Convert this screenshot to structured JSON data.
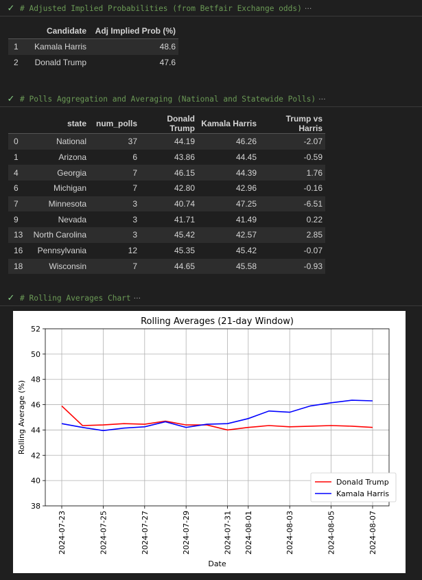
{
  "cells": [
    {
      "code": "# Adjusted Implied Probabilities (from Betfair Exchange odds)",
      "ellipsis": "···"
    },
    {
      "code": "# Polls Aggregation and Averaging (National and Statewide Polls)",
      "ellipsis": "···"
    },
    {
      "code": "# Rolling Averages Chart",
      "ellipsis": "···"
    }
  ],
  "prob_table": {
    "headers": [
      "",
      "Candidate",
      "Adj Implied Prob (%)"
    ],
    "rows": [
      [
        "1",
        "Kamala Harris",
        "48.6"
      ],
      [
        "2",
        "Donald Trump",
        "47.6"
      ]
    ]
  },
  "polls_table": {
    "headers": [
      "",
      "state",
      "num_polls",
      "Donald Trump",
      "Kamala Harris",
      "Trump vs Harris"
    ],
    "rows": [
      [
        "0",
        "National",
        "37",
        "44.19",
        "46.26",
        "-2.07"
      ],
      [
        "1",
        "Arizona",
        "6",
        "43.86",
        "44.45",
        "-0.59"
      ],
      [
        "4",
        "Georgia",
        "7",
        "46.15",
        "44.39",
        "1.76"
      ],
      [
        "6",
        "Michigan",
        "7",
        "42.80",
        "42.96",
        "-0.16"
      ],
      [
        "7",
        "Minnesota",
        "3",
        "40.74",
        "47.25",
        "-6.51"
      ],
      [
        "9",
        "Nevada",
        "3",
        "41.71",
        "41.49",
        "0.22"
      ],
      [
        "13",
        "North Carolina",
        "3",
        "45.42",
        "42.57",
        "2.85"
      ],
      [
        "16",
        "Pennsylvania",
        "12",
        "45.35",
        "45.42",
        "-0.07"
      ],
      [
        "18",
        "Wisconsin",
        "7",
        "44.65",
        "45.58",
        "-0.93"
      ]
    ]
  },
  "chart_data": {
    "type": "line",
    "title": "Rolling Averages (21-day Window)",
    "xlabel": "Date",
    "ylabel": "Rolling Average (%)",
    "x": [
      "2024-07-23",
      "2024-07-24",
      "2024-07-25",
      "2024-07-26",
      "2024-07-27",
      "2024-07-28",
      "2024-07-29",
      "2024-07-30",
      "2024-07-31",
      "2024-08-01",
      "2024-08-02",
      "2024-08-03",
      "2024-08-04",
      "2024-08-05",
      "2024-08-06",
      "2024-08-07"
    ],
    "xticks": [
      "2024-07-23",
      "2024-07-25",
      "2024-07-27",
      "2024-07-29",
      "2024-07-31",
      "2024-08-01",
      "2024-08-03",
      "2024-08-05",
      "2024-08-07"
    ],
    "ylim": [
      38,
      52
    ],
    "yticks": [
      38,
      40,
      42,
      44,
      46,
      48,
      50,
      52
    ],
    "grid": true,
    "legend": "lower-right",
    "series": [
      {
        "name": "Donald Trump",
        "color": "#ff0000",
        "values": [
          45.9,
          44.35,
          44.4,
          44.5,
          44.45,
          44.7,
          44.4,
          44.4,
          44.0,
          44.2,
          44.35,
          44.25,
          44.3,
          44.35,
          44.3,
          44.2
        ]
      },
      {
        "name": "Kamala Harris",
        "color": "#0000ff",
        "values": [
          44.5,
          44.2,
          43.95,
          44.15,
          44.25,
          44.65,
          44.2,
          44.45,
          44.5,
          44.9,
          45.5,
          45.4,
          45.9,
          46.15,
          46.35,
          46.3
        ]
      }
    ]
  }
}
